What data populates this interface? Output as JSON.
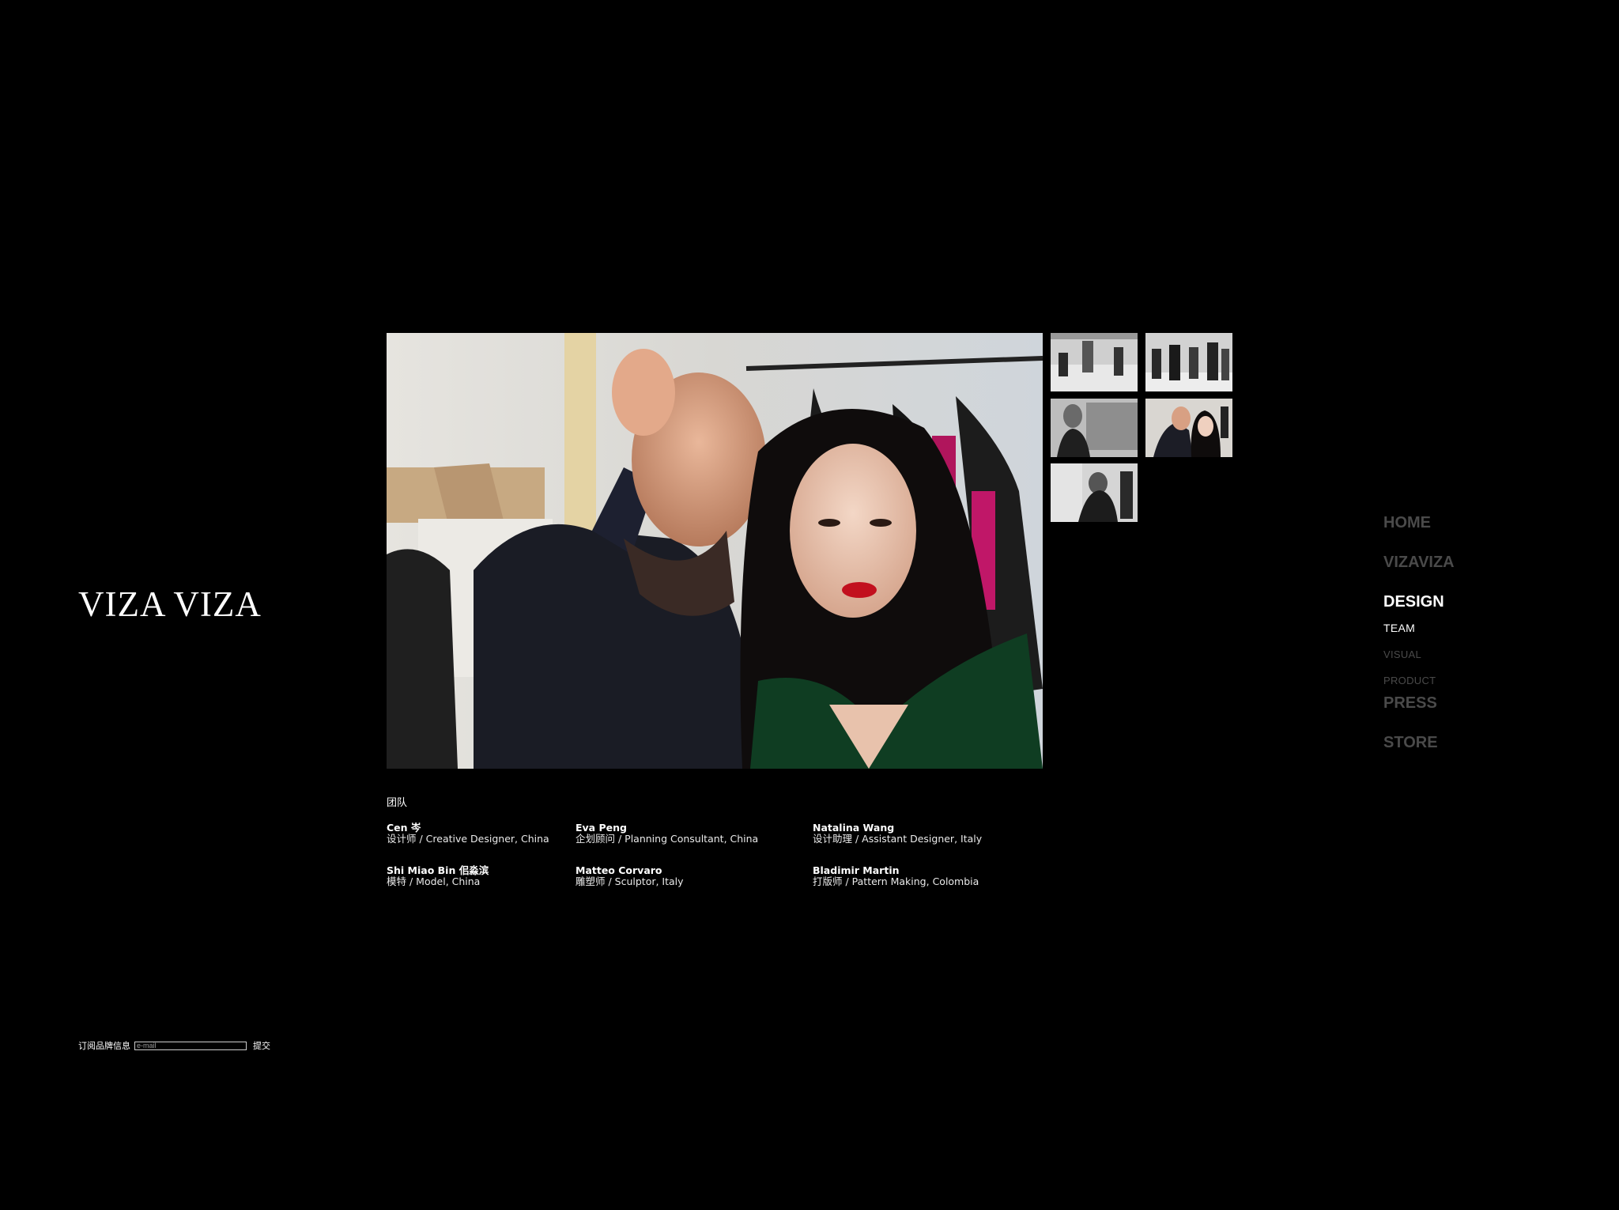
{
  "brand": {
    "logo_text": "VIZA VIZA"
  },
  "gallery": {
    "main_photo_alt": "main-photo",
    "thumbnails": [
      "thumb-1",
      "thumb-2",
      "thumb-3",
      "thumb-4",
      "thumb-5"
    ]
  },
  "team": {
    "heading": "团队",
    "members": [
      {
        "name": "Cen 岑",
        "role": "设计师 / Creative Designer, China"
      },
      {
        "name": "Eva Peng",
        "role": "企划顾问 / Planning Consultant, China"
      },
      {
        "name": "Natalina Wang",
        "role": "设计助理 / Assistant Designer, Italy"
      },
      {
        "name": "Shi Miao Bin 佀淼滨",
        "role": "模特 / Model, China"
      },
      {
        "name": "Matteo Corvaro",
        "role": "雕塑师 / Sculptor, Italy"
      },
      {
        "name": "Bladimir Martin",
        "role": "打版师 / Pattern Making, Colombia"
      }
    ]
  },
  "nav": {
    "home": "HOME",
    "vizaviza": "VIZAVIZA",
    "design": "DESIGN",
    "design_sub": {
      "team": "TEAM",
      "visual": "VISUAL",
      "product": "PRODUCT"
    },
    "press": "PRESS",
    "store": "STORE"
  },
  "subscribe": {
    "label": "订阅品牌信息",
    "placeholder": "e-mail",
    "submit": "提交"
  },
  "colors": {
    "background": "#000000",
    "nav_inactive": "#4a4a4a",
    "nav_active": "#ffffff"
  }
}
